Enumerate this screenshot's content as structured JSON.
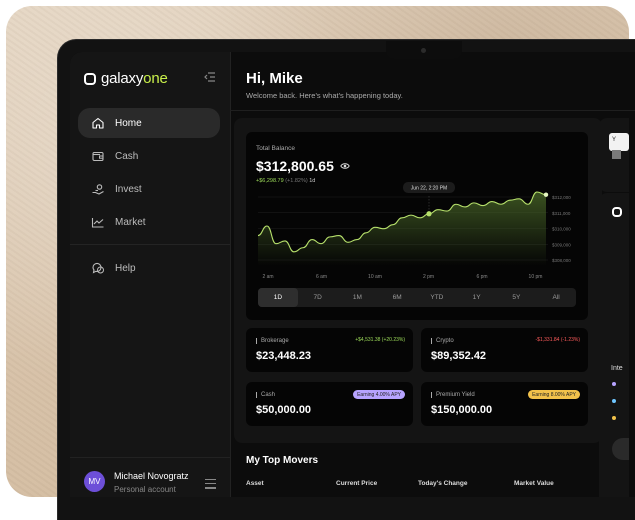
{
  "brand": {
    "name_plain": "galaxy",
    "name_accent": "one"
  },
  "nav": [
    {
      "label": "Home",
      "icon": "home-icon",
      "active": true
    },
    {
      "label": "Cash",
      "icon": "wallet-icon"
    },
    {
      "label": "Invest",
      "icon": "invest-icon"
    },
    {
      "label": "Market",
      "icon": "market-icon"
    },
    {
      "label": "Help",
      "icon": "help-icon"
    }
  ],
  "user": {
    "initials": "MV",
    "name": "Michael Novogratz",
    "sub": "Personal account"
  },
  "header": {
    "greeting": "Hi, Mike",
    "subtitle": "Welcome back. Here's what's happening today."
  },
  "balance": {
    "label": "Total Balance",
    "value": "$312,800.65",
    "change": "+$6,298.79",
    "change_pct": "(+1.82%)",
    "period": "1d",
    "tooltip": "Jun 22, 2:20 PM"
  },
  "chart_data": {
    "type": "area",
    "x_labels": [
      "2 am",
      "6 am",
      "10 am",
      "2 pm",
      "6 pm",
      "10 pm"
    ],
    "y_labels": [
      "$312,000",
      "$311,000",
      "$310,000",
      "$309,000",
      "$308,000"
    ],
    "values": [
      309600,
      310300,
      309000,
      309200,
      308400,
      308700,
      309300,
      309000,
      309500,
      309600,
      309100,
      309300,
      309800,
      310200,
      310100,
      310400,
      310900,
      311100,
      310900,
      311200,
      311500,
      311400,
      311900,
      311700,
      312000,
      311800,
      312100,
      311900,
      312200,
      312300,
      311900,
      312800,
      312600
    ],
    "highlight_index": 19,
    "ylim": [
      307800,
      312800
    ],
    "colors": {
      "line": "#b6e06b",
      "fill": "#4c6b29"
    }
  },
  "ranges": [
    "1D",
    "7D",
    "1M",
    "6M",
    "YTD",
    "1Y",
    "5Y",
    "All"
  ],
  "active_range": "1D",
  "cards": [
    {
      "label": "Brokerage",
      "value": "$23,448.23",
      "change": "+$4,531.38 (+20.23%)",
      "change_color": "#9ddc5a"
    },
    {
      "label": "Crypto",
      "value": "$89,352.42",
      "change": "-$1,331.84 (-1.23%)",
      "change_color": "#ff5c5c"
    },
    {
      "label": "Cash",
      "value": "$50,000.00",
      "badge": "Earning 4.00% APY",
      "badge_color": "#b7a3ff"
    },
    {
      "label": "Premium Yield",
      "value": "$150,000.00",
      "badge": "Earning 8.00% APY",
      "badge_color": "#f2c24b"
    }
  ],
  "movers": {
    "title": "My Top Movers",
    "columns": [
      "Asset",
      "Current Price",
      "Today's Change",
      "Market Value"
    ]
  },
  "right": {
    "pill": "Y",
    "section_label": "Inte",
    "dot_colors": [
      "#b7a3ff",
      "#6fc6ff",
      "#f2c24b"
    ]
  }
}
